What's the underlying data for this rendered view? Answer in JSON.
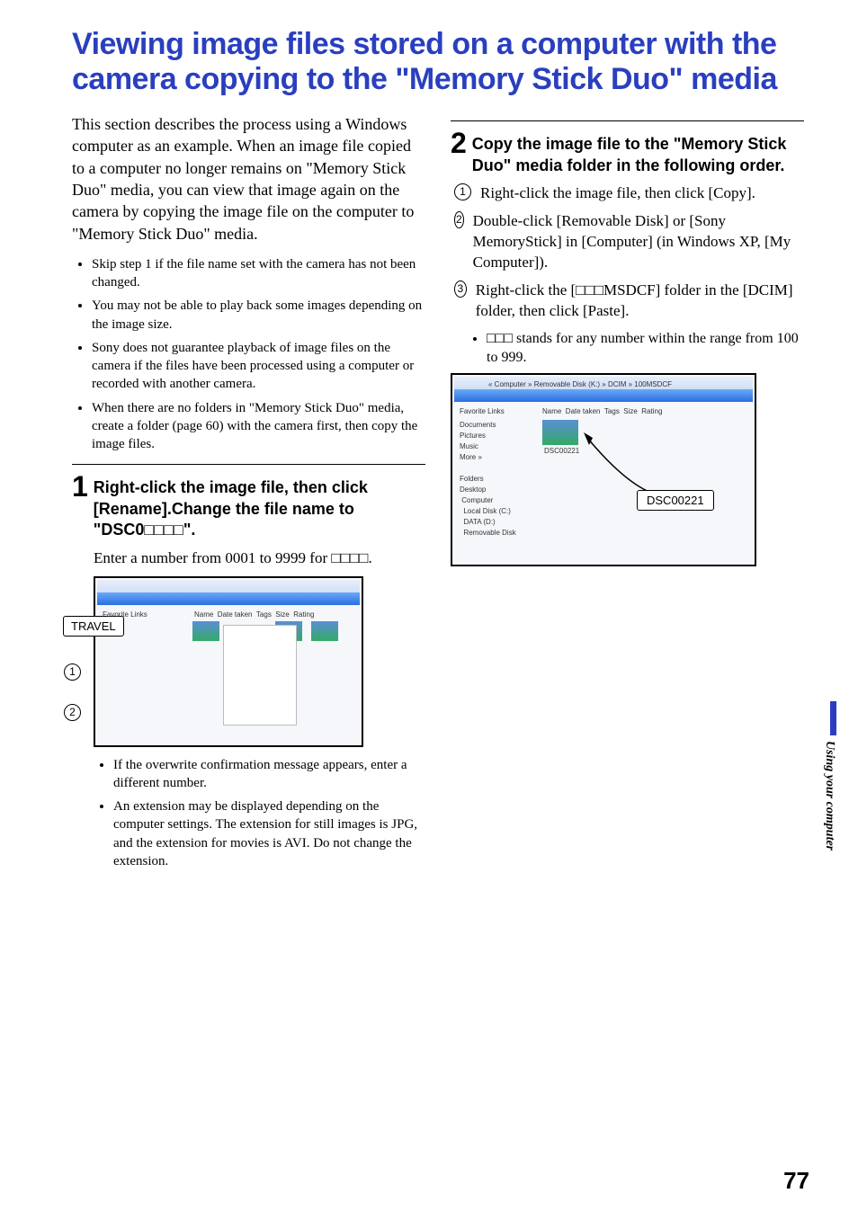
{
  "title": "Viewing image files stored on a computer with the camera copying to the \"Memory Stick Duo\" media",
  "intro": "This section describes the process using a Windows computer as an example. When an image file copied to a computer no longer remains on \"Memory Stick Duo\" media, you can view that image again on the camera by copying the image file on the computer to \"Memory Stick Duo\" media.",
  "notes": [
    "Skip step 1 if the file name set with the camera has not been changed.",
    "You may not be able to play back some images depending on the image size.",
    "Sony does not guarantee playback of image files on the camera if the files have been processed using a computer or recorded with another camera.",
    "When there are no folders in \"Memory Stick Duo\" media, create a folder (page 60) with the camera first, then copy the image files."
  ],
  "step1": {
    "num": "1",
    "heading": "Right-click the image file, then click [Rename].Change the file name to \"DSC0□□□□\".",
    "body": "Enter a number from 0001 to 9999 for □□□□.",
    "travel_label": "TRAVEL",
    "post_notes": [
      "If the overwrite confirmation message appears, enter a different number.",
      "An extension may be displayed depending on the computer settings. The extension for still images is JPG, and the extension for movies is AVI. Do not change the extension."
    ]
  },
  "step2": {
    "num": "2",
    "heading": "Copy the image file to the \"Memory Stick Duo\" media folder in the following order.",
    "subs": [
      "Right-click the image file, then click [Copy].",
      "Double-click [Removable Disk] or [Sony MemoryStick] in [Computer] (in Windows XP, [My Computer]).",
      "Right-click the [□□□MSDCF] folder in the [DCIM] folder, then click [Paste]."
    ],
    "sub_note": "□□□ stands for any number within the range from 100 to 999.",
    "callout": "DSC00221"
  },
  "side_label": "Using your computer",
  "page_number": "77"
}
